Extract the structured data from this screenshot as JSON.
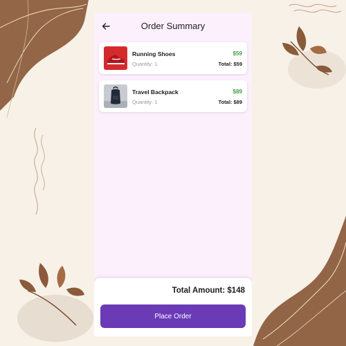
{
  "header": {
    "title": "Order Summary",
    "back_icon": "arrow-left-icon"
  },
  "items": [
    {
      "name": "Running Shoes",
      "quantity_text": "Quantity: 1",
      "price": "$59",
      "total_text": "Total: $59",
      "thumbnail": "red-running-shoe-photo"
    },
    {
      "name": "Travel Backpack",
      "quantity_text": "Quantity: 1",
      "price": "$89",
      "total_text": "Total: $89",
      "thumbnail": "dark-backpack-photo"
    }
  ],
  "footer": {
    "total_amount": "Total Amount: $148",
    "place_order_label": "Place Order"
  },
  "colors": {
    "accent": "#6a3ab7",
    "price_green": "#43a047",
    "screen_background": "#fbf0fb",
    "page_background": "#f7f1e8"
  }
}
